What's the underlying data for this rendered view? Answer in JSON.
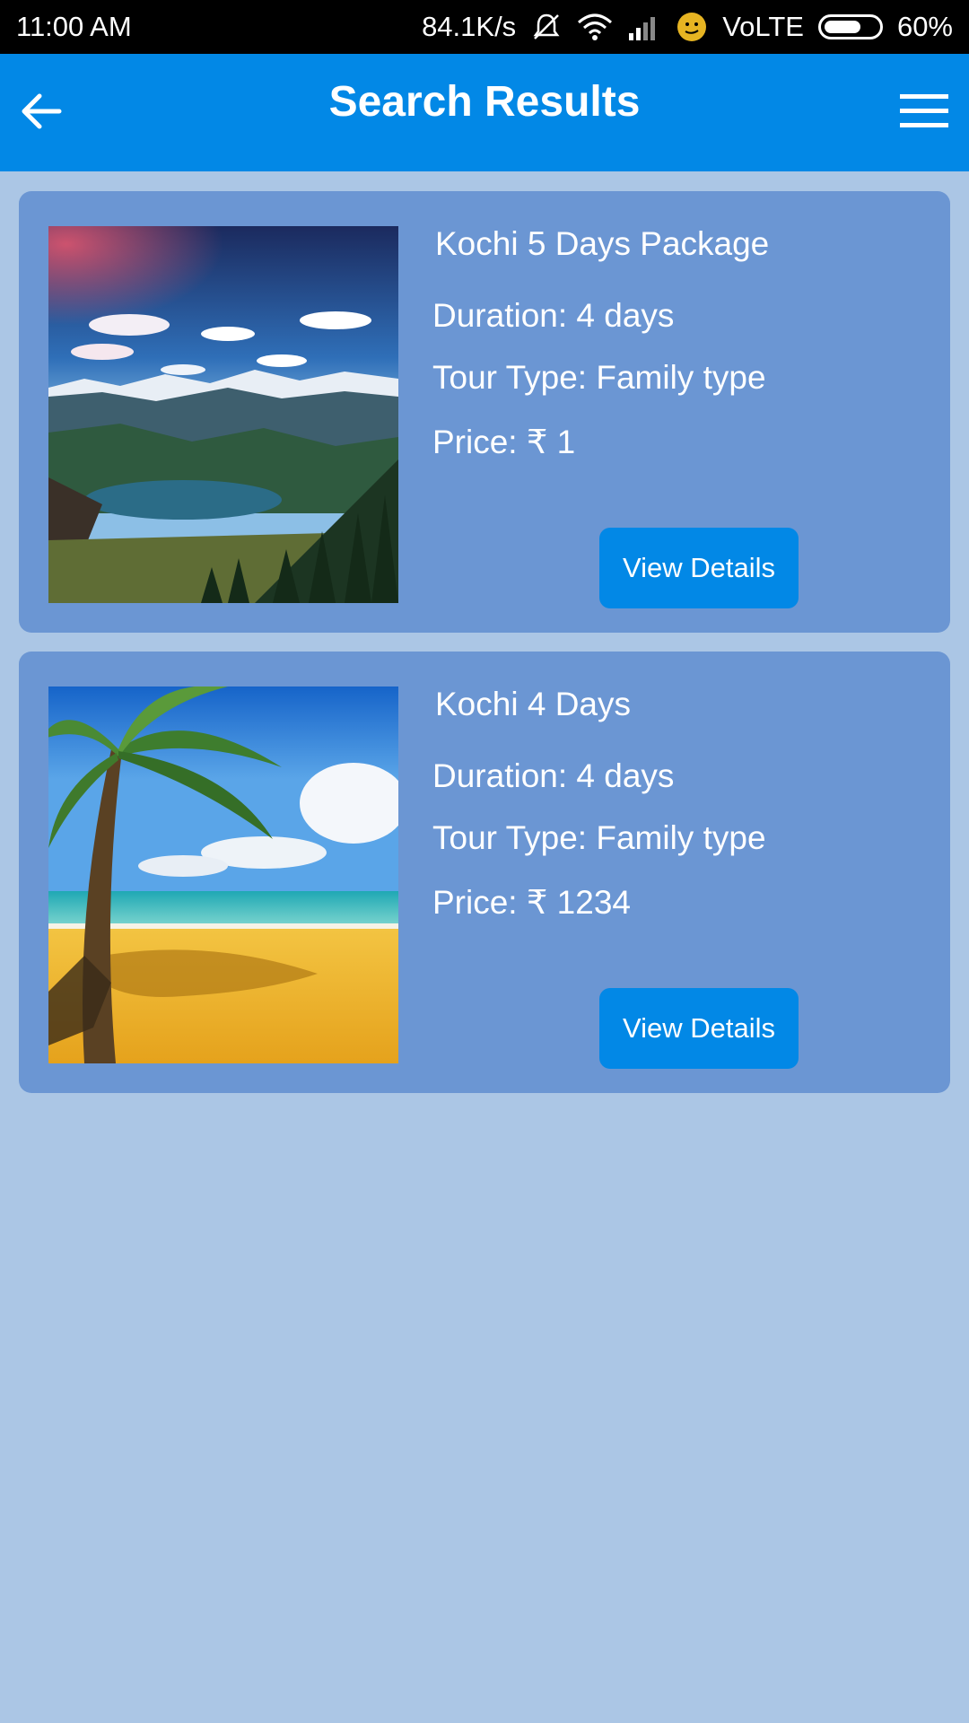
{
  "status_bar": {
    "time": "11:00 AM",
    "net_speed": "84.1K/s",
    "network": "VoLTE",
    "battery": "60%",
    "icons": [
      "mute-icon",
      "wifi-icon",
      "signal-icon",
      "emoji-icon",
      "battery-icon"
    ]
  },
  "app_bar": {
    "title": "Search Results",
    "back_icon": "arrow-left-icon",
    "menu_icon": "hamburger-menu-icon"
  },
  "results": [
    {
      "title": "Kochi 5 Days Package",
      "duration": "Duration: 4 days",
      "tour_type": "Tour Type: Family type",
      "price": "Price: ₹ 1",
      "button": "View Details",
      "image": "mountain-lake-image"
    },
    {
      "title": "Kochi 4 Days",
      "duration": "Duration: 4 days",
      "tour_type": "Tour Type: Family type",
      "price": "Price: ₹ 1234",
      "button": "View Details",
      "image": "palm-beach-image"
    }
  ],
  "colors": {
    "app_bar": "#0288e6",
    "card": "#6b96d3",
    "background": "#abc6e5",
    "button": "#0288e6"
  }
}
